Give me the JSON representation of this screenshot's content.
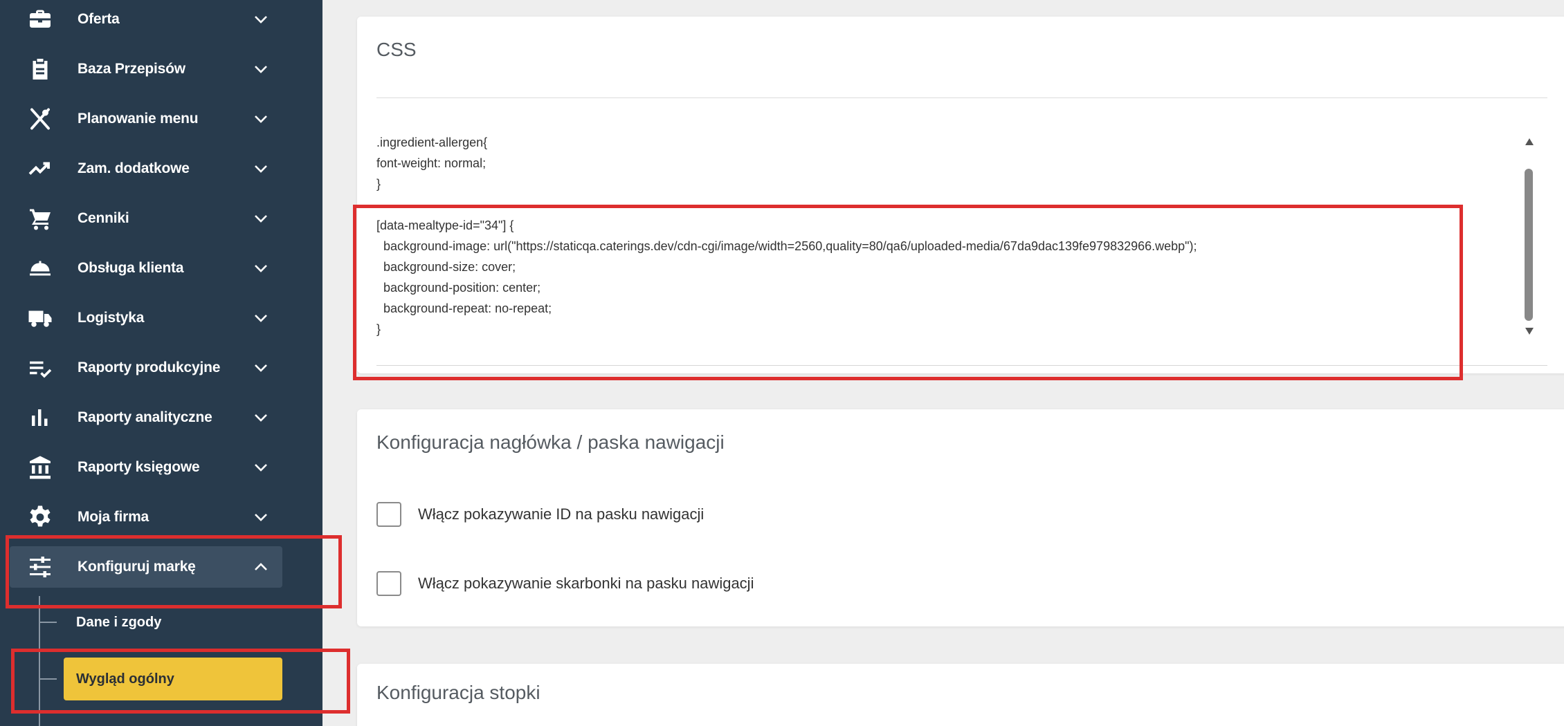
{
  "sidebar": {
    "items": [
      {
        "label": "Oferta",
        "icon": "briefcase-icon"
      },
      {
        "label": "Baza Przepisów",
        "icon": "clipboard-icon"
      },
      {
        "label": "Planowanie menu",
        "icon": "utensils-icon"
      },
      {
        "label": "Zam. dodatkowe",
        "icon": "trending-up-icon"
      },
      {
        "label": "Cenniki",
        "icon": "cart-icon"
      },
      {
        "label": "Obsługa klienta",
        "icon": "service-bell-icon"
      },
      {
        "label": "Logistyka",
        "icon": "truck-icon"
      },
      {
        "label": "Raporty produkcyjne",
        "icon": "list-check-icon"
      },
      {
        "label": "Raporty analityczne",
        "icon": "bar-chart-icon"
      },
      {
        "label": "Raporty księgowe",
        "icon": "bank-icon"
      },
      {
        "label": "Moja firma",
        "icon": "gear-icon"
      },
      {
        "label": "Konfiguruj markę",
        "icon": "sliders-icon"
      }
    ],
    "subitems": [
      {
        "label": "Dane i zgody"
      },
      {
        "label": "Wygląd ogólny"
      }
    ]
  },
  "css_card": {
    "title": "CSS",
    "code_lines": [
      ".ingredient-allergen{",
      "font-weight: normal;",
      "}",
      "",
      "[data-mealtype-id=\"34\"] {",
      "  background-image: url(\"https://staticqa.caterings.dev/cdn-cgi/image/width=2560,quality=80/qa6/uploaded-media/67da9dac139fe979832966.webp\");",
      "  background-size: cover;",
      "  background-position: center;",
      "  background-repeat: no-repeat;",
      "}"
    ]
  },
  "nav_card": {
    "title": "Konfiguracja nagłówka / paska nawigacji",
    "checkboxes": [
      {
        "label": "Włącz pokazywanie ID na pasku nawigacji",
        "checked": false
      },
      {
        "label": "Włącz pokazywanie skarbonki na pasku nawigacji",
        "checked": false
      }
    ]
  },
  "footer_card": {
    "title": "Konfiguracja stopki"
  },
  "colors": {
    "sidebar_bg": "#283b4d",
    "active_item_bg": "#3c4f62",
    "current_subitem_bg": "#efc43a",
    "highlight_red": "#dd2e2e"
  }
}
